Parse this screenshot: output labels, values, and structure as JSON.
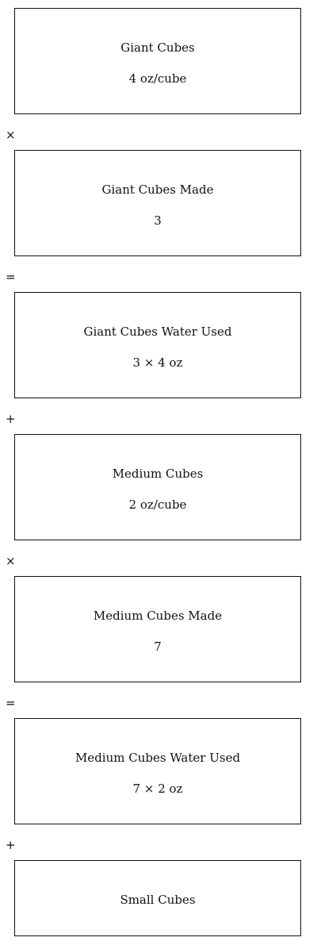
{
  "cards": [
    {
      "title": "Giant Cubes",
      "value": "4 oz/cube"
    },
    {
      "title": "Giant Cubes Made",
      "value": "3"
    },
    {
      "title": "Giant Cubes Water Used",
      "value": "3 × 4 oz"
    },
    {
      "title": "Medium Cubes",
      "value": "2 oz/cube"
    },
    {
      "title": "Medium Cubes Made",
      "value": "7"
    },
    {
      "title": "Medium Cubes Water Used",
      "value": "7 × 2 oz"
    },
    {
      "title": "Small Cubes"
    }
  ],
  "operators": [
    "×",
    "=",
    "+",
    "×",
    "=",
    "+"
  ]
}
